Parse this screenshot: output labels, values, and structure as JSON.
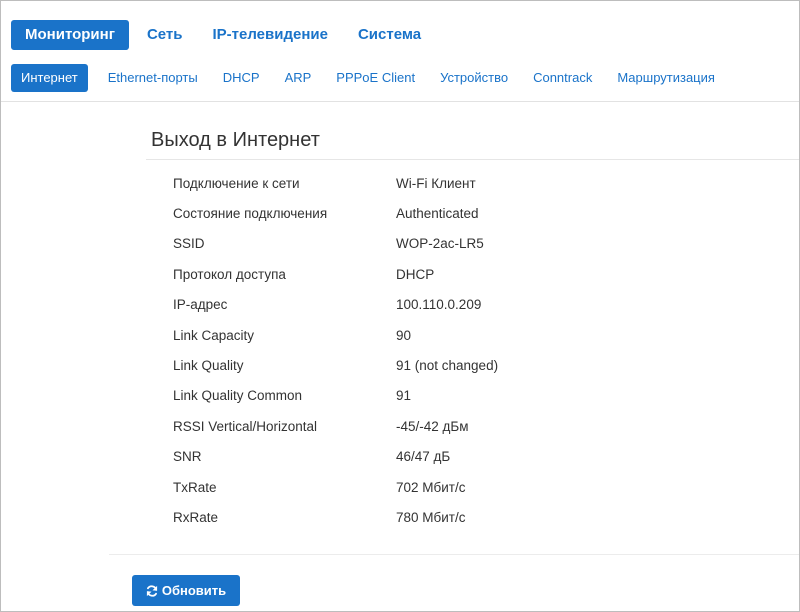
{
  "main_menu": {
    "items": [
      {
        "label": "Мониторинг",
        "active": true
      },
      {
        "label": "Сеть",
        "active": false
      },
      {
        "label": "IP-телевидение",
        "active": false
      },
      {
        "label": "Система",
        "active": false
      }
    ]
  },
  "sub_menu": {
    "items": [
      {
        "label": "Интернет",
        "active": true
      },
      {
        "label": "Ethernet-порты",
        "active": false
      },
      {
        "label": "DHCP",
        "active": false
      },
      {
        "label": "ARP",
        "active": false
      },
      {
        "label": "PPPoE Client",
        "active": false
      },
      {
        "label": "Устройство",
        "active": false
      },
      {
        "label": "Conntrack",
        "active": false
      },
      {
        "label": "Маршрутизация",
        "active": false
      }
    ]
  },
  "panel": {
    "title": "Выход в Интернет",
    "rows": [
      {
        "label": "Подключение к сети",
        "value": "Wi-Fi Клиент"
      },
      {
        "label": "Состояние подключения",
        "value": "Authenticated"
      },
      {
        "label": "SSID",
        "value": "WOP-2ac-LR5"
      },
      {
        "label": "Протокол доступа",
        "value": "DHCP"
      },
      {
        "label": "IP-адрес",
        "value": "100.110.0.209"
      },
      {
        "label": "Link Capacity",
        "value": "90"
      },
      {
        "label": "Link Quality",
        "value": "91 (not changed)"
      },
      {
        "label": "Link Quality Common",
        "value": "91"
      },
      {
        "label": "RSSI Vertical/Horizontal",
        "value": "-45/-42 дБм"
      },
      {
        "label": "SNR",
        "value": "46/47 дБ"
      },
      {
        "label": "TxRate",
        "value": "702 Мбит/с"
      },
      {
        "label": "RxRate",
        "value": "780 Мбит/с"
      }
    ]
  },
  "actions": {
    "refresh_label": "Обновить",
    "refresh_icon": "refresh-icon"
  },
  "colors": {
    "accent": "#1a73c9",
    "text": "#333333"
  }
}
